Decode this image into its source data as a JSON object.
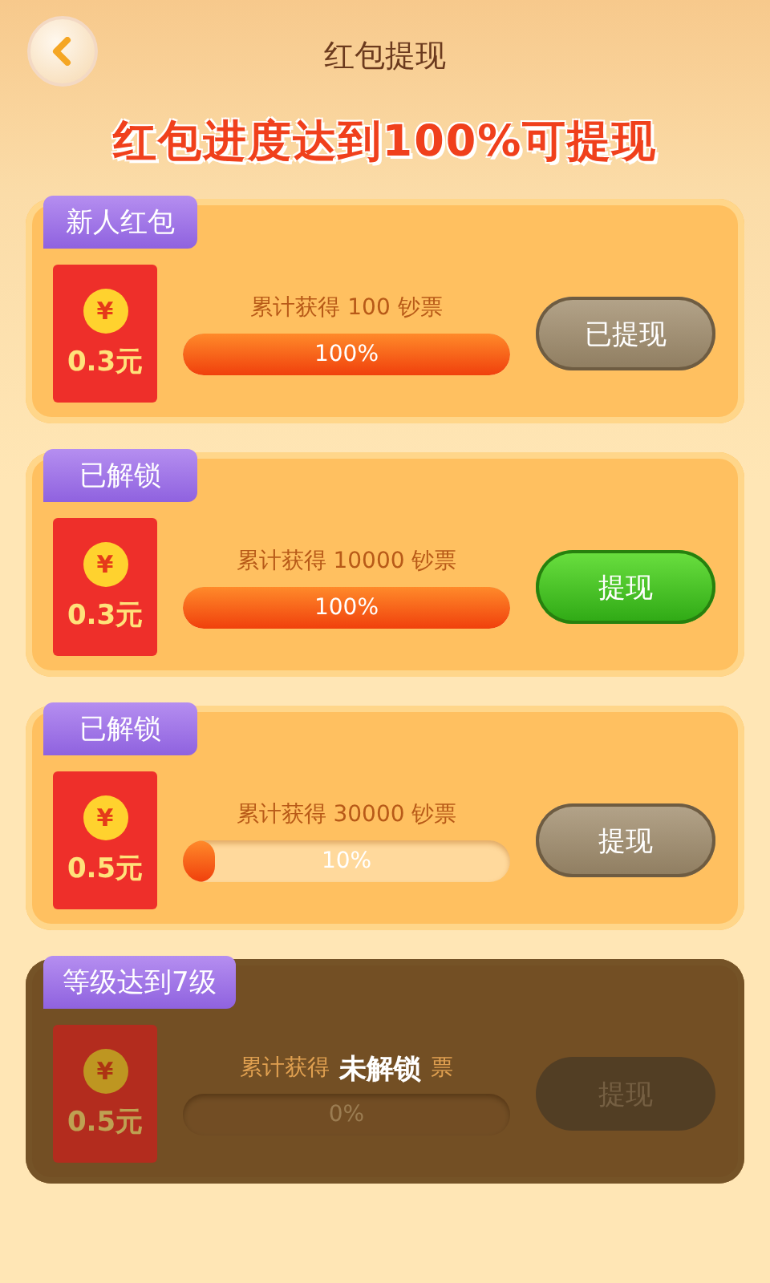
{
  "header": {
    "title": "红包提现"
  },
  "banner": "红包进度达到100%可提现",
  "cards": [
    {
      "tag": "新人红包",
      "amount": "0.3元",
      "currency": "¥",
      "caption": "累计获得 100 钞票",
      "level": 1,
      "percent": "100%",
      "button": "已提现",
      "kind": "withdrawn"
    },
    {
      "tag": "已解锁",
      "amount": "0.3元",
      "currency": "¥",
      "caption": "累计获得 10000 钞票",
      "level": 1,
      "percent": "100%",
      "button": "提现",
      "kind": "ready"
    },
    {
      "tag": "已解锁",
      "amount": "0.5元",
      "currency": "¥",
      "caption": "累计获得 30000 钞票",
      "level": 0.1,
      "percent": "10%",
      "button": "提现",
      "kind": "pending"
    },
    {
      "tag": "等级达到7级",
      "amount": "0.5元",
      "currency": "¥",
      "caption": "累计获得",
      "caption_end": "票",
      "lock_text": "未解锁",
      "level": 0,
      "percent": "0%",
      "button": "提现",
      "kind": "locked"
    }
  ]
}
